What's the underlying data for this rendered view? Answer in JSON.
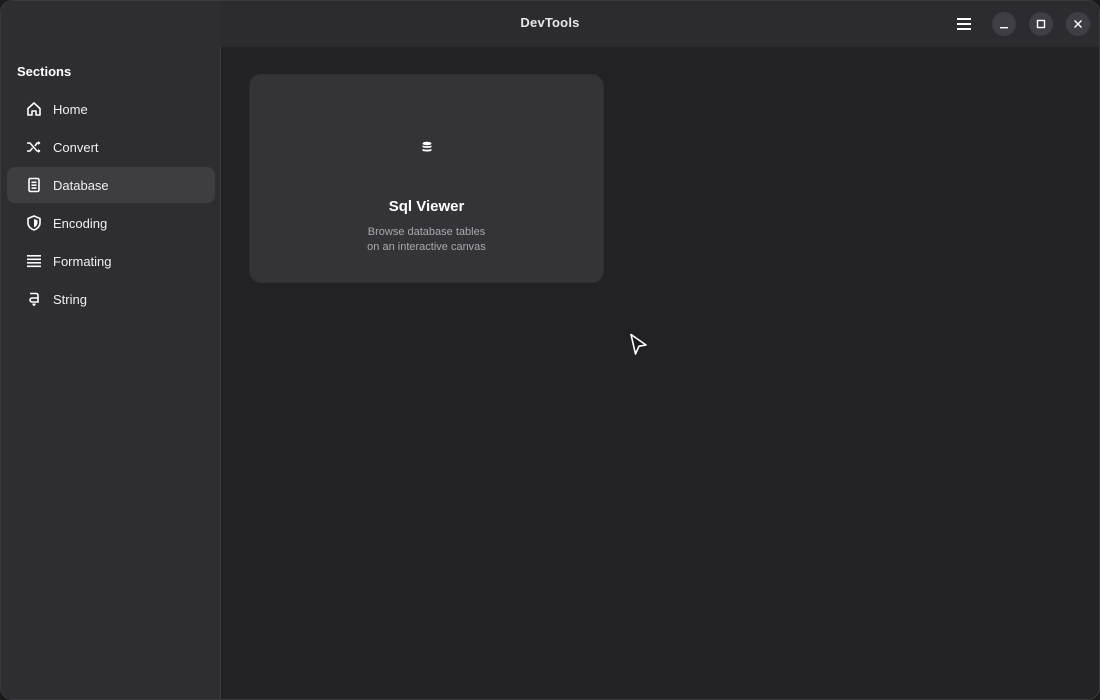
{
  "window": {
    "title": "DevTools"
  },
  "sidebar": {
    "title": "Sections",
    "items": [
      {
        "label": "Home",
        "icon": "home-icon",
        "active": false
      },
      {
        "label": "Convert",
        "icon": "shuffle-icon",
        "active": false
      },
      {
        "label": "Database",
        "icon": "database-icon",
        "active": true
      },
      {
        "label": "Encoding",
        "icon": "shield-icon",
        "active": false
      },
      {
        "label": "Formating",
        "icon": "lines-icon",
        "active": false
      },
      {
        "label": "String",
        "icon": "text-icon",
        "active": false
      }
    ]
  },
  "main": {
    "tools": [
      {
        "title": "Sql Viewer",
        "icon": "database-icon",
        "description_line1": "Browse database tables",
        "description_line2": "on an interactive canvas"
      }
    ]
  },
  "colors": {
    "window_bg": "#222226",
    "sidebar_bg": "#2e2e32",
    "card_bg": "#333338",
    "active_item_bg": "#3d3d42",
    "text": "#ffffff",
    "muted_text": "#a8a8ad"
  }
}
